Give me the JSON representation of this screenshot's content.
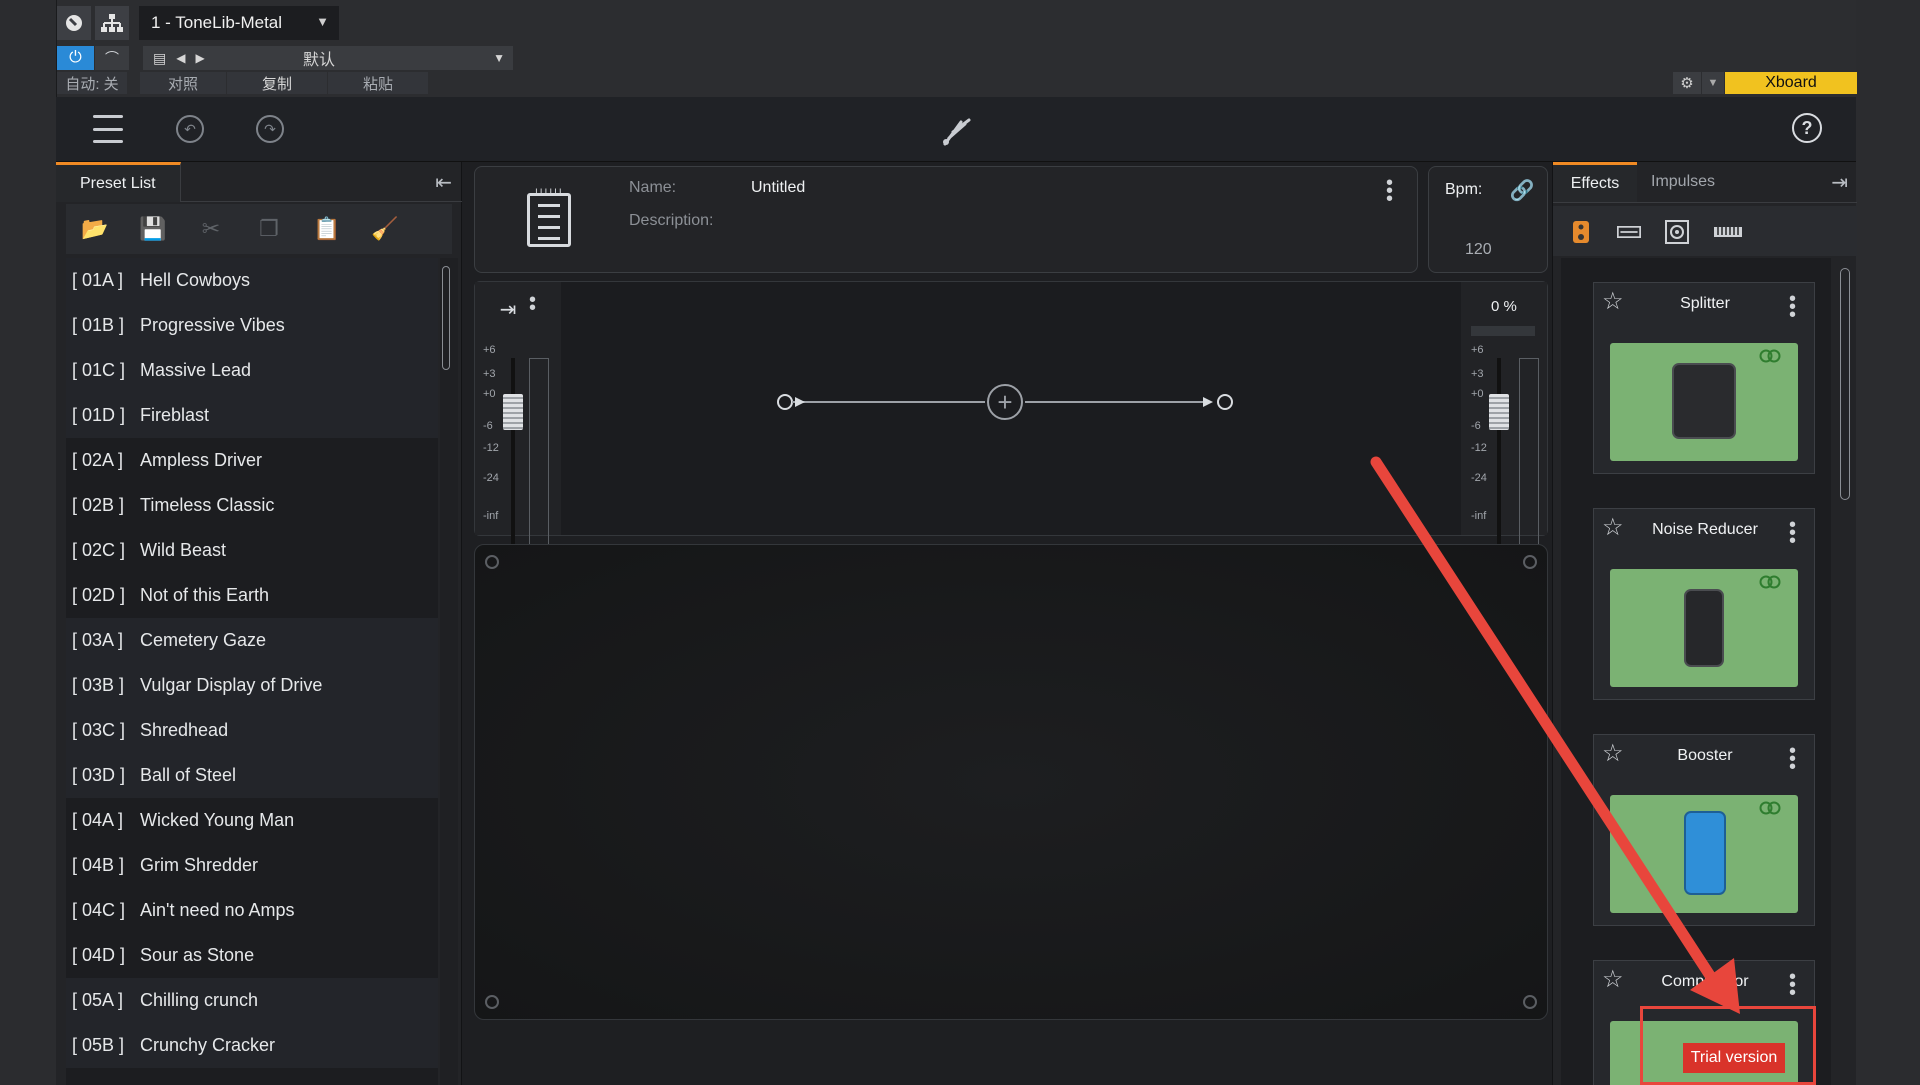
{
  "host": {
    "track_name": "1 - ToneLib-Metal",
    "preset_name": "默认",
    "auto_label": "自动: 关",
    "compare_label": "对照",
    "copy_label": "复制",
    "paste_label": "粘贴",
    "xboard_label": "Xboard"
  },
  "left_panel": {
    "tab_label": "Preset List",
    "presets": [
      {
        "code": "[ 01A ]",
        "name": "Hell Cowboys"
      },
      {
        "code": "[ 01B ]",
        "name": "Progressive Vibes"
      },
      {
        "code": "[ 01C ]",
        "name": "Massive Lead"
      },
      {
        "code": "[ 01D ]",
        "name": "Fireblast"
      },
      {
        "code": "[ 02A ]",
        "name": "Ampless Driver"
      },
      {
        "code": "[ 02B ]",
        "name": "Timeless Classic"
      },
      {
        "code": "[ 02C ]",
        "name": "Wild Beast"
      },
      {
        "code": "[ 02D ]",
        "name": "Not of this Earth"
      },
      {
        "code": "[ 03A ]",
        "name": "Cemetery Gaze"
      },
      {
        "code": "[ 03B ]",
        "name": "Vulgar Display of Drive"
      },
      {
        "code": "[ 03C ]",
        "name": "Shredhead"
      },
      {
        "code": "[ 03D ]",
        "name": "Ball of Steel"
      },
      {
        "code": "[ 04A ]",
        "name": "Wicked Young Man"
      },
      {
        "code": "[ 04B ]",
        "name": "Grim Shredder"
      },
      {
        "code": "[ 04C ]",
        "name": "Ain't need no Amps"
      },
      {
        "code": "[ 04D ]",
        "name": "Sour as Stone"
      },
      {
        "code": "[ 05A ]",
        "name": "Chilling crunch"
      },
      {
        "code": "[ 05B ]",
        "name": "Crunchy Cracker"
      }
    ]
  },
  "info": {
    "name_label": "Name:",
    "name_value": "Untitled",
    "description_label": "Description:",
    "bpm_label": "Bpm:",
    "bpm_value": "120"
  },
  "meters": {
    "scale": [
      "+6",
      "+3",
      "+0",
      "-6",
      "-12",
      "-24",
      "-inf"
    ],
    "output_percent": "0 %"
  },
  "right_panel": {
    "tab_effects": "Effects",
    "tab_impulses": "Impulses",
    "effects": [
      {
        "name": "Splitter"
      },
      {
        "name": "Noise Reducer"
      },
      {
        "name": "Booster"
      },
      {
        "name": "Compressor"
      }
    ],
    "trial_label": "Trial version"
  },
  "colors": {
    "accent": "#f08a24",
    "xboard": "#f1c21f",
    "fx_card_bg": "#7bb273",
    "annotation_red": "#e8463c"
  }
}
